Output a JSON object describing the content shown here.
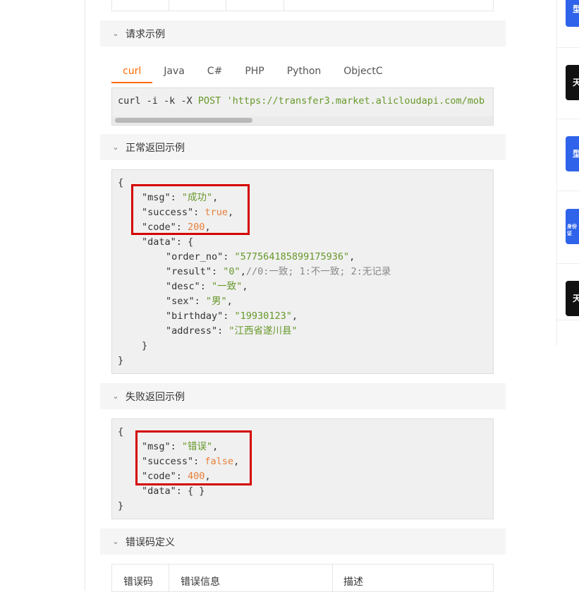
{
  "sections": {
    "request_example": "请求示例",
    "normal_return": "正常返回示例",
    "fail_return": "失败返回示例",
    "error_codes": "错误码定义"
  },
  "tabs": [
    {
      "label": "curl",
      "active": true
    },
    {
      "label": "Java",
      "active": false
    },
    {
      "label": "C#",
      "active": false
    },
    {
      "label": "PHP",
      "active": false
    },
    {
      "label": "Python",
      "active": false
    },
    {
      "label": "ObjectC",
      "active": false
    }
  ],
  "curl": {
    "cmd": "curl -i -k -X ",
    "method": "POST",
    "url": " 'https://transfer3.market.alicloudapi.com/mob"
  },
  "normal_json": {
    "open": "{",
    "msg_key": "\"msg\"",
    "msg_val": "\"成功\"",
    "success_key": "\"success\"",
    "success_val": "true",
    "code_key": "\"code\"",
    "code_val": "200",
    "data_key": "\"data\"",
    "order_no_key": "\"order_no\"",
    "order_no_val": "\"577564185899175936\"",
    "result_key": "\"result\"",
    "result_val": "\"0\"",
    "result_comment": "//0:一致; 1:不一致; 2:无记录",
    "desc_key": "\"desc\"",
    "desc_val": "\"一致\"",
    "sex_key": "\"sex\"",
    "sex_val": "\"男\"",
    "birthday_key": "\"birthday\"",
    "birthday_val": "\"19930123\"",
    "address_key": "\"address\"",
    "address_val": "\"江西省遂川县\"",
    "inner_close": "}",
    "close": "}"
  },
  "fail_json": {
    "open": "{",
    "msg_key": "\"msg\"",
    "msg_val": "\"错误\"",
    "success_key": "\"success\"",
    "success_val": "false",
    "code_key": "\"code\"",
    "code_val": "400",
    "data_key": "\"data\"",
    "data_val": "{ }",
    "close": "}"
  },
  "error_table": {
    "headers": [
      "错误码",
      "错误信息",
      "描述"
    ]
  },
  "sidebar": {
    "cards": [
      {
        "text": "型",
        "color": "#2f63ea"
      },
      {
        "text": "天",
        "color": "#111111"
      },
      {
        "text": "型",
        "color": "#2f63ea"
      },
      {
        "text": "身份证",
        "color": "#2f63ea"
      },
      {
        "text": "天",
        "color": "#111111"
      }
    ]
  },
  "colors": {
    "accent": "#ff6a00",
    "highlight_box": "#d40000",
    "string": "#67982a",
    "keyword": "#e8803a"
  }
}
